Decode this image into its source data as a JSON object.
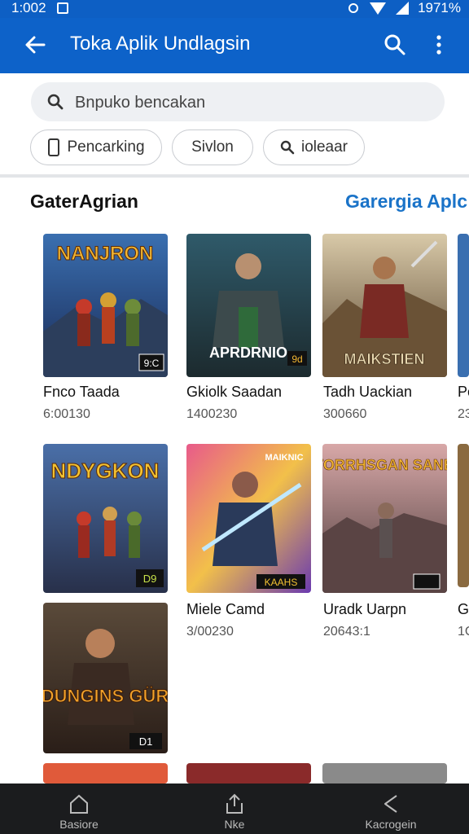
{
  "status": {
    "time": "1:002",
    "battery": "1971%"
  },
  "appbar": {
    "title": "Toka Aplik Undlagsin",
    "back_icon": "arrow-back-icon",
    "search_icon": "search-icon",
    "more_icon": "more-vert-icon"
  },
  "search": {
    "placeholder": "Bnpuko bencakan"
  },
  "chips": [
    {
      "label": "Pencarking",
      "icon": "phone-icon"
    },
    {
      "label": "Sivlon"
    },
    {
      "label": "ioleaar",
      "icon": "search-icon"
    }
  ],
  "section": {
    "title": "GaterAgrian",
    "link": "Garergia Aplc a"
  },
  "games": [
    {
      "name": "Fnco Taada",
      "count": "6:00130",
      "art_title": "NANJRON",
      "badge": "9:C"
    },
    {
      "name": "Gkiolk Saadan",
      "count": "1400230",
      "art_title": "APRDRNIO",
      "badge": "9d"
    },
    {
      "name": "Tadh Uackian",
      "count": "300660",
      "art_title": "MAIKSTIEN"
    },
    {
      "name": "Pc",
      "count": "23"
    },
    {
      "art_title": "NDYGKON",
      "badge": "D9"
    },
    {
      "name": "Miele Camd",
      "count": "3/00230",
      "art_title": "MAIKNIC",
      "badge": "KAAHS"
    },
    {
      "name": "Uradk Uarpn",
      "count": "20643:1",
      "art_title": "TORRHSGAN SANB"
    },
    {
      "name": "Gc",
      "count": "1C"
    },
    {
      "art_title": "DUNGINS GÜR",
      "badge": "D1"
    }
  ],
  "colors": {
    "appbar": "#0d62c9",
    "link": "#1a73c8",
    "navbar": "#1b1c1e"
  },
  "nav": [
    {
      "label": "Basiore",
      "icon": "home-icon"
    },
    {
      "label": "Nke",
      "icon": "share-icon"
    },
    {
      "label": "Kacrogein",
      "icon": "back-triangle-icon"
    }
  ]
}
